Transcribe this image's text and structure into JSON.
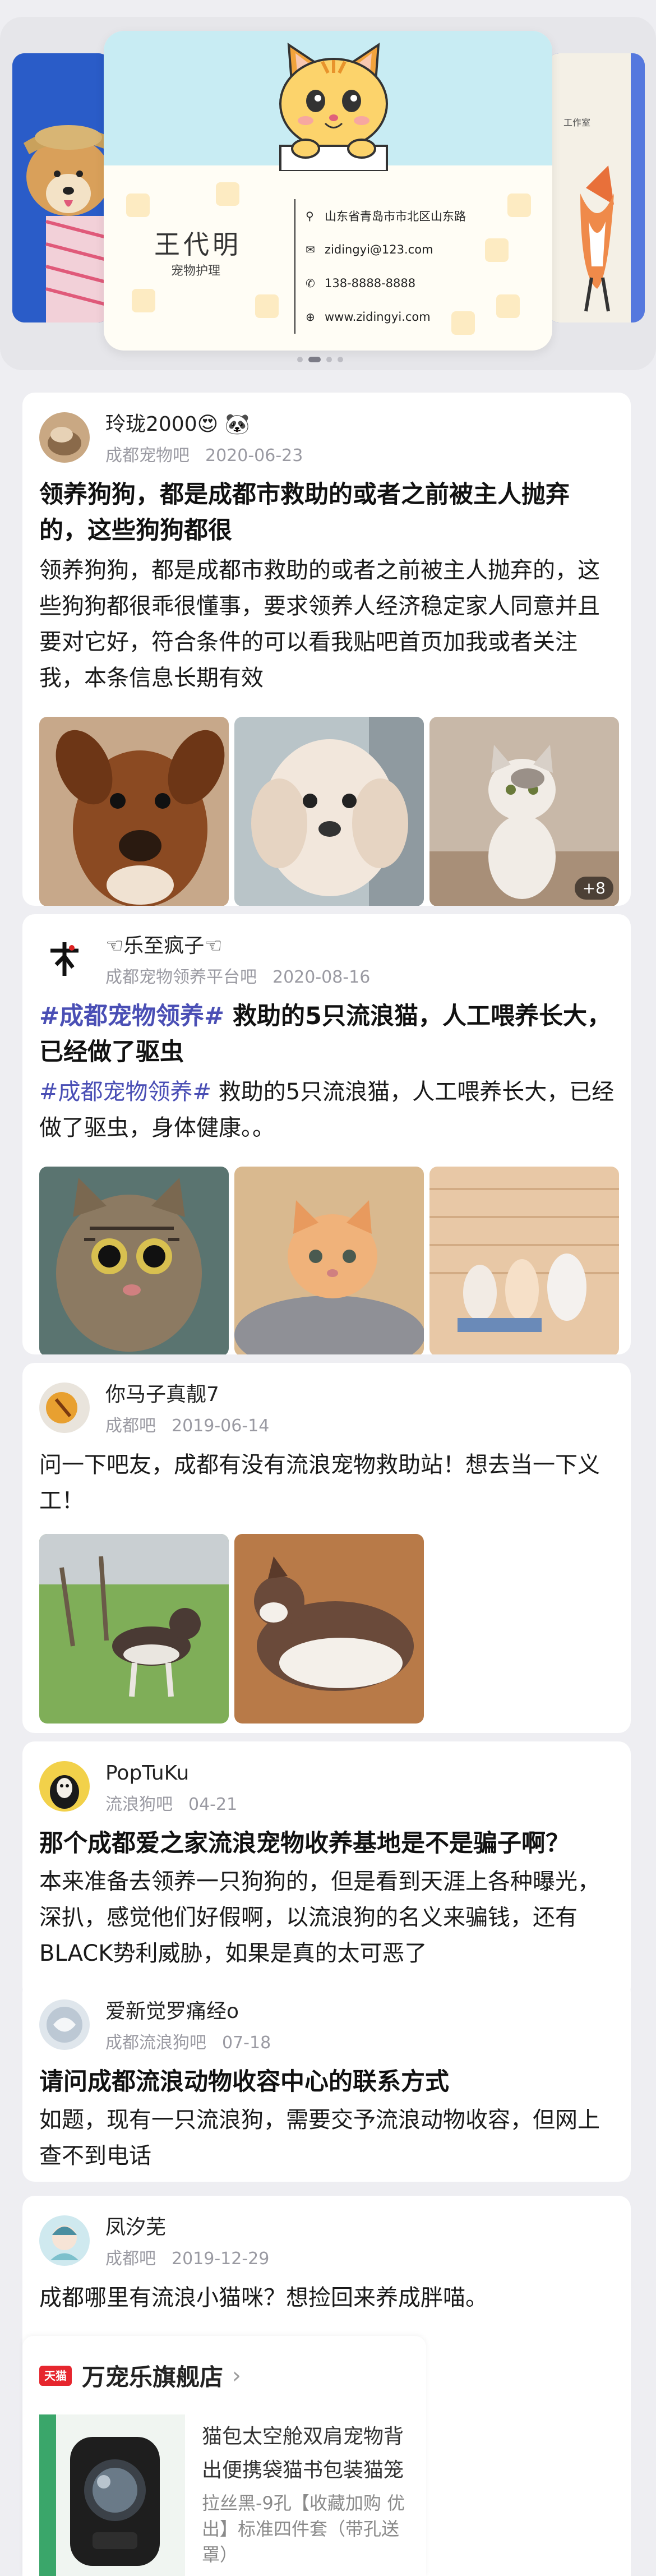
{
  "banner": {
    "card_name": "王代明",
    "card_title": "宠物护理",
    "info": [
      {
        "icon": "location-pin-icon",
        "glyph": "⚲",
        "text": "山东省青岛市市北区山东路"
      },
      {
        "icon": "mail-icon",
        "glyph": "✉",
        "text": "zidingyi@123.com"
      },
      {
        "icon": "phone-icon",
        "glyph": "✆",
        "text": "138-8888-8888"
      },
      {
        "icon": "globe-icon",
        "glyph": "⊕",
        "text": "www.zidingyi.com"
      }
    ],
    "right_card_text": "工作室",
    "active_page": 1,
    "page_count": 4
  },
  "posts": [
    {
      "username": "玲珑2000😍 🐼",
      "forum": "成都宠物吧",
      "date": "2020-06-23",
      "title": "领养狗狗，都是成都市救助的或者之前被主人抛弃的，这些狗狗都很",
      "body": "领养狗狗，都是成都市救助的或者之前被主人抛弃的，这些狗狗都很乖很懂事，要求领养人经济稳定家人同意并且要对它好，符合条件的可以看我贴吧首页加我或者关注我，本条信息长期有效",
      "more_count": "+8"
    },
    {
      "username": "☜乐至疯子☜",
      "forum": "成都宠物领养平台吧",
      "date": "2020-08-16",
      "title_tag": "#成都宠物领养#",
      "title": " 救助的5只流浪猫，人工喂养长大，已经做了驱虫",
      "body_tag": "#成都宠物领养#",
      "body": " 救助的5只流浪猫，人工喂养长大，已经做了驱虫，身体健康。。"
    },
    {
      "username": "你马子真靓7",
      "forum": "成都吧",
      "date": "2019-06-14",
      "body": "问一下吧友，成都有没有流浪宠物救助站！想去当一下义工！"
    },
    {
      "username": "PopTuKu",
      "forum": "流浪狗吧",
      "date": "04-21",
      "title": "那个成都爱之家流浪宠物收养基地是不是骗子啊？",
      "body": "本来准备去领养一只狗狗的，但是看到天涯上各种曝光，深扒，感觉他们好假啊，以流浪狗的名义来骗钱，还有BLACK势利威胁，如果是真的太可恶了"
    },
    {
      "username": "爱新觉罗痛经o",
      "forum": "成都流浪狗吧",
      "date": "07-18",
      "title": "请问成都流浪动物收容中心的联系方式",
      "body": "如题，现有一只流浪狗，需要交予流浪动物收容，但网上查不到电话"
    },
    {
      "username": "凤汐芜",
      "forum": "成都吧",
      "date": "2019-12-29",
      "body": "成都哪里有流浪小猫咪？想捡回来养成胖喵。"
    }
  ],
  "shop": {
    "badge": "天猫",
    "name": "万宠乐旗舰店",
    "arrow": "›",
    "product_title": "猫包太空舱双肩宠物背出便携袋猫书包装猫笼",
    "product_sub": "拉丝黑-9孔【收藏加购 优出】标准四件套（带孔送罩）"
  }
}
